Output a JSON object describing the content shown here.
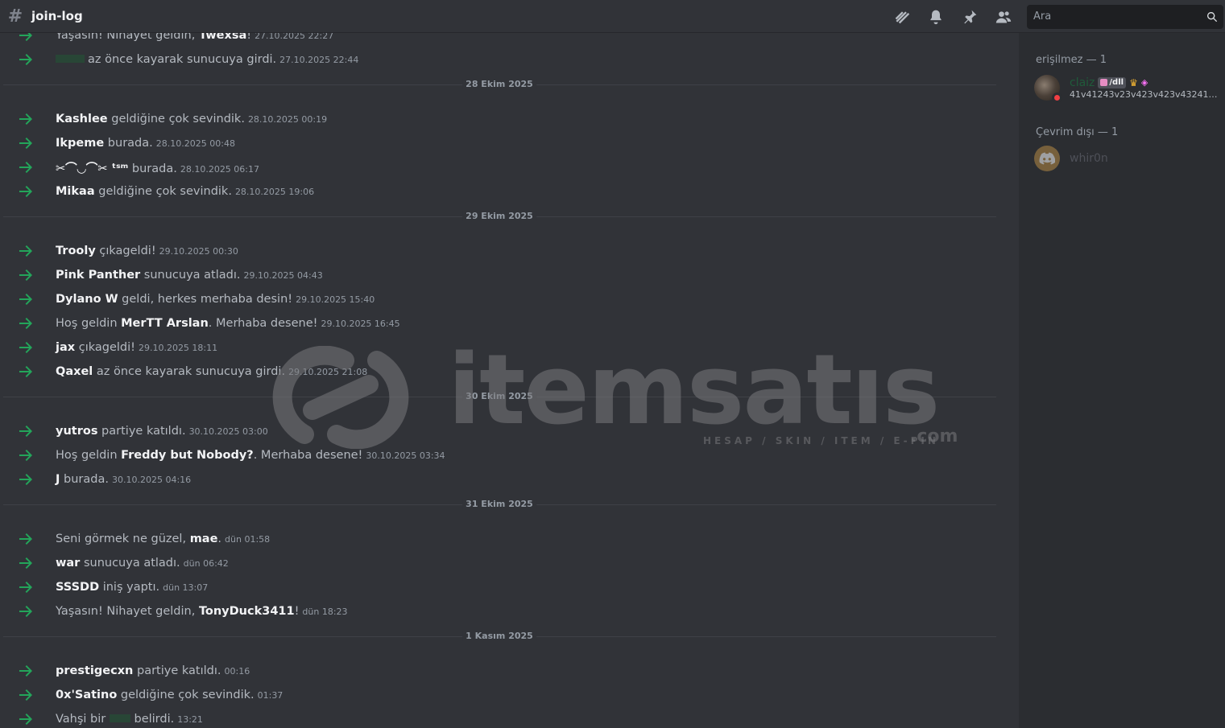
{
  "header": {
    "channel_name": "join-log",
    "search_placeholder": "Ara",
    "icons": [
      "threads-icon",
      "bell-icon",
      "pin-icon",
      "members-icon",
      "search-icon"
    ]
  },
  "messages": [
    {
      "type": "msg",
      "pre": "Yaşasın! Nihayet geldin, ",
      "user": "Twexsa",
      "post": "!",
      "ts": "27.10.2025 22:27"
    },
    {
      "type": "msg",
      "pre": "",
      "user": "",
      "post": "az önce kayarak sunucuya girdi.",
      "ts": "27.10.2025 22:44",
      "hidden_user": true
    },
    {
      "type": "divider",
      "label": "28 Ekim 2025"
    },
    {
      "type": "msg",
      "pre": "",
      "user": "Kashlee",
      "post": " geldiğine çok sevindik.",
      "ts": "28.10.2025 00:19"
    },
    {
      "type": "msg",
      "pre": "",
      "user": "Ikpeme",
      "post": " burada.",
      "ts": "28.10.2025 00:48"
    },
    {
      "type": "msg",
      "pre": "",
      "user": "✂⌒◡⌒✂ ᵗˢᵐ",
      "post": " burada.",
      "ts": "28.10.2025 06:17"
    },
    {
      "type": "msg",
      "pre": "",
      "user": "Mikaa",
      "post": " geldiğine çok sevindik.",
      "ts": "28.10.2025 19:06"
    },
    {
      "type": "divider",
      "label": "29 Ekim 2025"
    },
    {
      "type": "msg",
      "pre": "",
      "user": "Trooly",
      "post": " çıkageldi!",
      "ts": "29.10.2025 00:30"
    },
    {
      "type": "msg",
      "pre": "",
      "user": "Pink Panther",
      "post": " sunucuya atladı.",
      "ts": "29.10.2025 04:43"
    },
    {
      "type": "msg",
      "pre": "",
      "user": "Dylano W",
      "post": " geldi, herkes merhaba desin!",
      "ts": "29.10.2025 15:40"
    },
    {
      "type": "msg",
      "pre": "Hoş geldin ",
      "user": "MerTT Arslan",
      "post": ". Merhaba desene!",
      "ts": "29.10.2025 16:45"
    },
    {
      "type": "msg",
      "pre": "",
      "user": "jax",
      "post": " çıkageldi!",
      "ts": "29.10.2025 18:11"
    },
    {
      "type": "msg",
      "pre": "",
      "user": "Qaxel",
      "post": " az önce kayarak sunucuya girdi.",
      "ts": "29.10.2025 21:08"
    },
    {
      "type": "divider",
      "label": "30 Ekim 2025"
    },
    {
      "type": "msg",
      "pre": "",
      "user": "yutros",
      "post": " partiye katıldı.",
      "ts": "30.10.2025 03:00"
    },
    {
      "type": "msg",
      "pre": "Hoş geldin ",
      "user": "Freddy but Nobody?",
      "post": ". Merhaba desene!",
      "ts": "30.10.2025 03:34"
    },
    {
      "type": "msg",
      "pre": "",
      "user": "J",
      "post": " burada.",
      "ts": "30.10.2025 04:16"
    },
    {
      "type": "divider",
      "label": "31 Ekim 2025"
    },
    {
      "type": "msg",
      "pre": "Seni görmek ne güzel, ",
      "user": "mae",
      "post": ".",
      "ts": "dün 01:58"
    },
    {
      "type": "msg",
      "pre": "",
      "user": "war",
      "post": " sunucuya atladı.",
      "ts": "dün 06:42"
    },
    {
      "type": "msg",
      "pre": "",
      "user": "SSSDD",
      "post": " iniş yaptı.",
      "ts": "dün 13:07"
    },
    {
      "type": "msg",
      "pre": "Yaşasın! Nihayet geldin, ",
      "user": "TonyDuck3411",
      "post": "!",
      "ts": "dün 18:23"
    },
    {
      "type": "divider",
      "label": "1 Kasım 2025"
    },
    {
      "type": "msg",
      "pre": "",
      "user": "prestigecxn",
      "post": " partiye katıldı.",
      "ts": "00:16"
    },
    {
      "type": "msg",
      "pre": "",
      "user": "0x'Satino",
      "post": " geldiğine çok sevindik.",
      "ts": "01:37"
    },
    {
      "type": "msg",
      "pre": "Vahşi bir ",
      "user": "",
      "post": " belirdi.",
      "ts": "13:21",
      "hidden_user": true
    }
  ],
  "members": {
    "unreachable_title": "erişilmez — 1",
    "offline_title": "Çevrim dışı — 1",
    "member1": {
      "name": "claiz",
      "tag": "/dll",
      "status": "41v41243v23v423v423v43241329..."
    },
    "member2": {
      "name": "whir0n"
    }
  },
  "watermark": {
    "brand": "itemsatıs",
    "tagline": "HESAP / SKIN / ITEM / E-PIN",
    "domain": ".com"
  },
  "colors": {
    "join_arrow": "#23a55a",
    "background": "#313338",
    "sidebar": "#2b2d31",
    "dnd": "#f23f43"
  }
}
